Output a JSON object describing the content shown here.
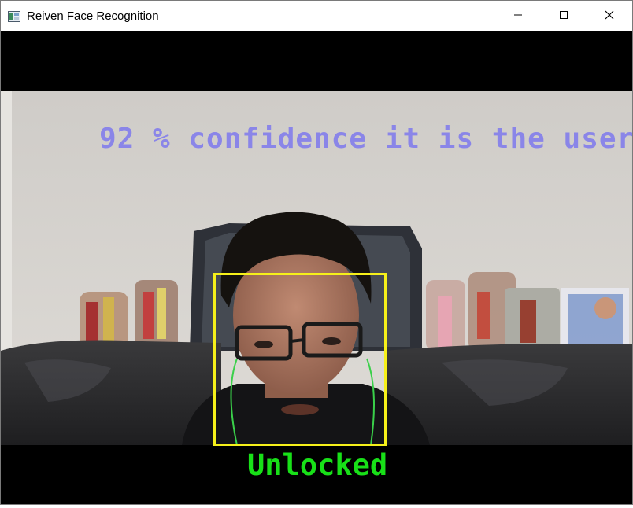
{
  "window": {
    "title": "Reiven Face Recognition"
  },
  "icons": {
    "app": "app-window-icon",
    "minimize": "minimize-icon",
    "maximize": "maximize-icon",
    "close": "close-icon"
  },
  "overlay": {
    "confidence_text": "92 % confidence it is the user",
    "status_text": "Unlocked",
    "confidence_color": "#8a85e8",
    "status_color": "#18e018",
    "face_box_color": "#f6f01a"
  }
}
